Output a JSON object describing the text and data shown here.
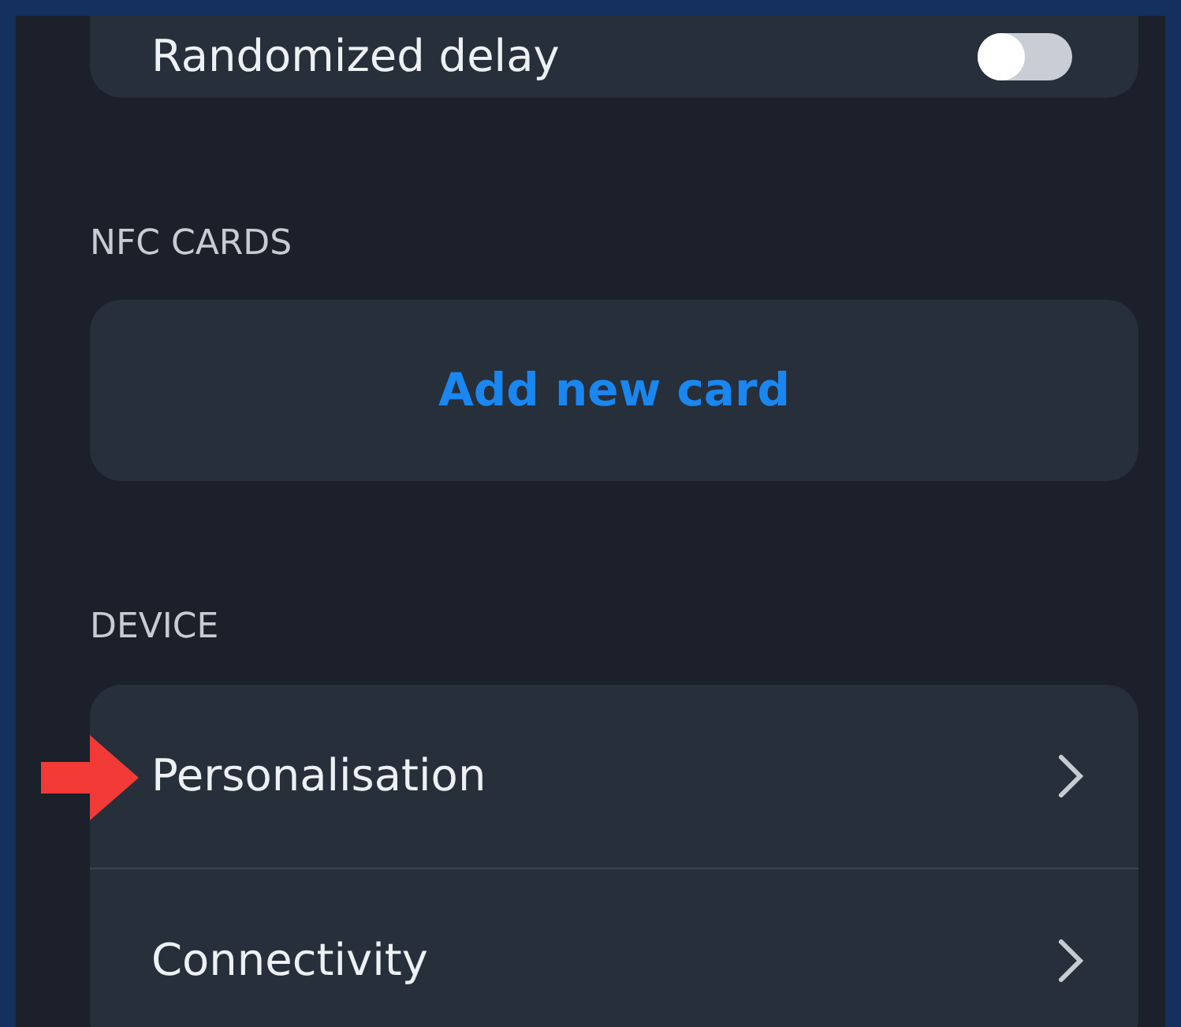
{
  "top_setting": {
    "label": "Randomized delay",
    "on": false
  },
  "nfc_section": {
    "heading": "NFC CARDS",
    "action": "Add new card"
  },
  "device_section": {
    "heading": "DEVICE",
    "items": [
      {
        "label": "Personalisation",
        "pointed": true
      },
      {
        "label": "Connectivity",
        "pointed": false
      }
    ]
  }
}
